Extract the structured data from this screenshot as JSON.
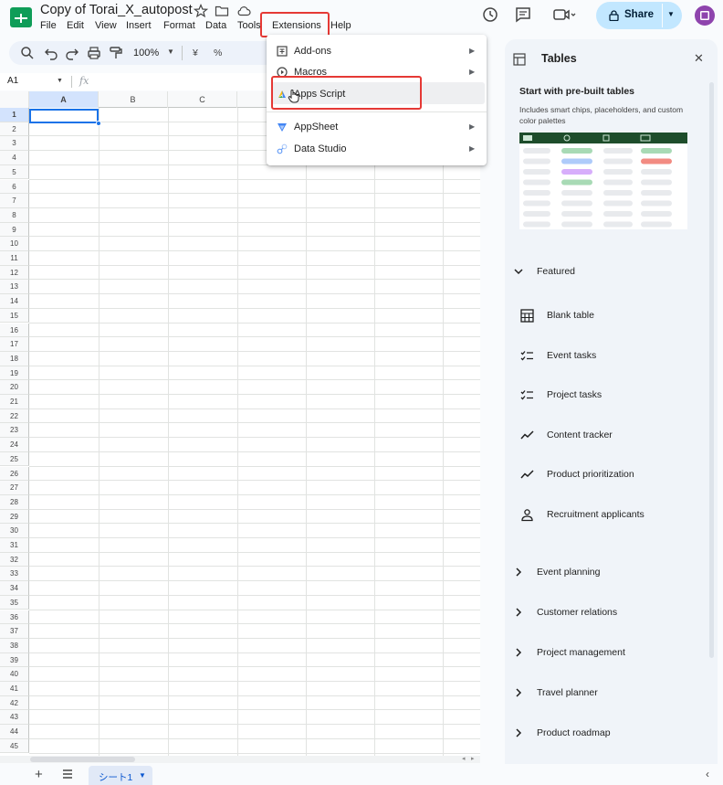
{
  "header": {
    "doc_title": "Copy of Torai_X_autopost",
    "share_label": "Share",
    "menu": [
      "File",
      "Edit",
      "View",
      "Insert",
      "Format",
      "Data",
      "Tools",
      "Extensions",
      "Help"
    ]
  },
  "toolbar": {
    "zoom": "100%",
    "currency_symbol": "¥",
    "percent_symbol": "%"
  },
  "formula_bar": {
    "cell_ref": "A1",
    "fx_label": "fx"
  },
  "grid": {
    "columns": [
      "A",
      "B",
      "C"
    ],
    "rows": [
      "1",
      "2",
      "3",
      "4",
      "5",
      "6",
      "7",
      "8",
      "9",
      "10",
      "11",
      "12",
      "13",
      "14",
      "15",
      "16",
      "17",
      "18",
      "19",
      "20",
      "21",
      "22",
      "23",
      "24",
      "25",
      "26",
      "27",
      "28",
      "29",
      "30",
      "31",
      "32",
      "33",
      "34",
      "35",
      "36",
      "37",
      "38",
      "39",
      "40",
      "41",
      "42",
      "43",
      "44",
      "45"
    ]
  },
  "extensions_menu": {
    "items": [
      {
        "label": "Add-ons",
        "icon": "addons-icon",
        "has_submenu": true
      },
      {
        "label": "Macros",
        "icon": "macros-icon",
        "has_submenu": true
      },
      {
        "label": "Apps Script",
        "icon": "apps-script-icon",
        "has_submenu": false
      },
      {
        "label": "AppSheet",
        "icon": "appsheet-icon",
        "has_submenu": true
      },
      {
        "label": "Data Studio",
        "icon": "data-studio-icon",
        "has_submenu": true
      }
    ]
  },
  "side_panel": {
    "title": "Tables",
    "heading": "Start with pre-built tables",
    "description": "Includes smart chips, placeholders, and custom color palettes",
    "featured_label": "Featured",
    "featured_items": [
      {
        "label": "Blank table",
        "icon": "table-icon"
      },
      {
        "label": "Event tasks",
        "icon": "checklist-icon"
      },
      {
        "label": "Project tasks",
        "icon": "checklist-icon"
      },
      {
        "label": "Content tracker",
        "icon": "trend-icon"
      },
      {
        "label": "Product prioritization",
        "icon": "trend-icon"
      },
      {
        "label": "Recruitment applicants",
        "icon": "person-icon"
      }
    ],
    "sections": [
      "Event planning",
      "Customer relations",
      "Project management",
      "Travel planner",
      "Product roadmap"
    ]
  },
  "sheets": {
    "active_tab": "シート1"
  },
  "colors": {
    "accent_blue": "#1a73e8",
    "share_bg": "#c2e7ff",
    "highlight_red": "#e53935",
    "sheets_green": "#0f9d58"
  }
}
